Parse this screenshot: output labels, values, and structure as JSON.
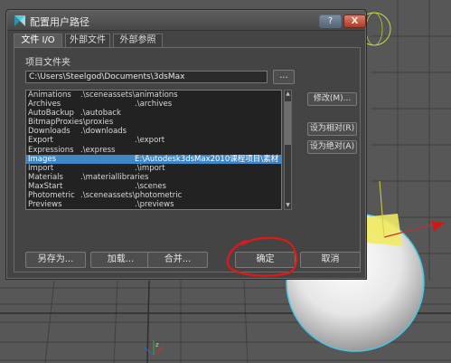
{
  "window": {
    "title": "配置用户路径",
    "help_label": "?",
    "close_label": "X"
  },
  "tabs": [
    {
      "label": "文件 I/O",
      "active": true
    },
    {
      "label": "外部文件",
      "active": false
    },
    {
      "label": "外部参照",
      "active": false
    }
  ],
  "project": {
    "label": "项目文件夹",
    "path": "C:\\Users\\Steelgod\\Documents\\3dsMax",
    "browse_label": "..."
  },
  "paths": [
    {
      "name": "Animations",
      "value": ".\\sceneassets\\animations"
    },
    {
      "name": "Archives",
      "value": ".\\archives"
    },
    {
      "name": "AutoBackup",
      "value": ".\\autoback"
    },
    {
      "name": "BitmapProxies",
      "value": ".\\proxies"
    },
    {
      "name": "Downloads",
      "value": ".\\downloads"
    },
    {
      "name": "Export",
      "value": ".\\export"
    },
    {
      "name": "Expressions",
      "value": ".\\express"
    },
    {
      "name": "Images",
      "value": "E:\\Autodesk3dsMax2010课程项目\\素材",
      "selected": true
    },
    {
      "name": "Import",
      "value": ".\\import"
    },
    {
      "name": "Materials",
      "value": ".\\materiallibraries"
    },
    {
      "name": "MaxStart",
      "value": ".\\scenes"
    },
    {
      "name": "Photometric",
      "value": ".\\sceneassets\\photometric"
    },
    {
      "name": "Previews",
      "value": ".\\previews"
    }
  ],
  "side_buttons": {
    "modify": "修改(M)...",
    "make_relative": "设为相对(R)",
    "make_absolute": "设为绝对(A)"
  },
  "bottom_buttons": {
    "save_as": "另存为...",
    "load": "加载...",
    "merge": "合并...",
    "ok": "确定",
    "cancel": "取消"
  },
  "colors": {
    "selection": "#3f86c6",
    "annotation": "#e01818"
  }
}
